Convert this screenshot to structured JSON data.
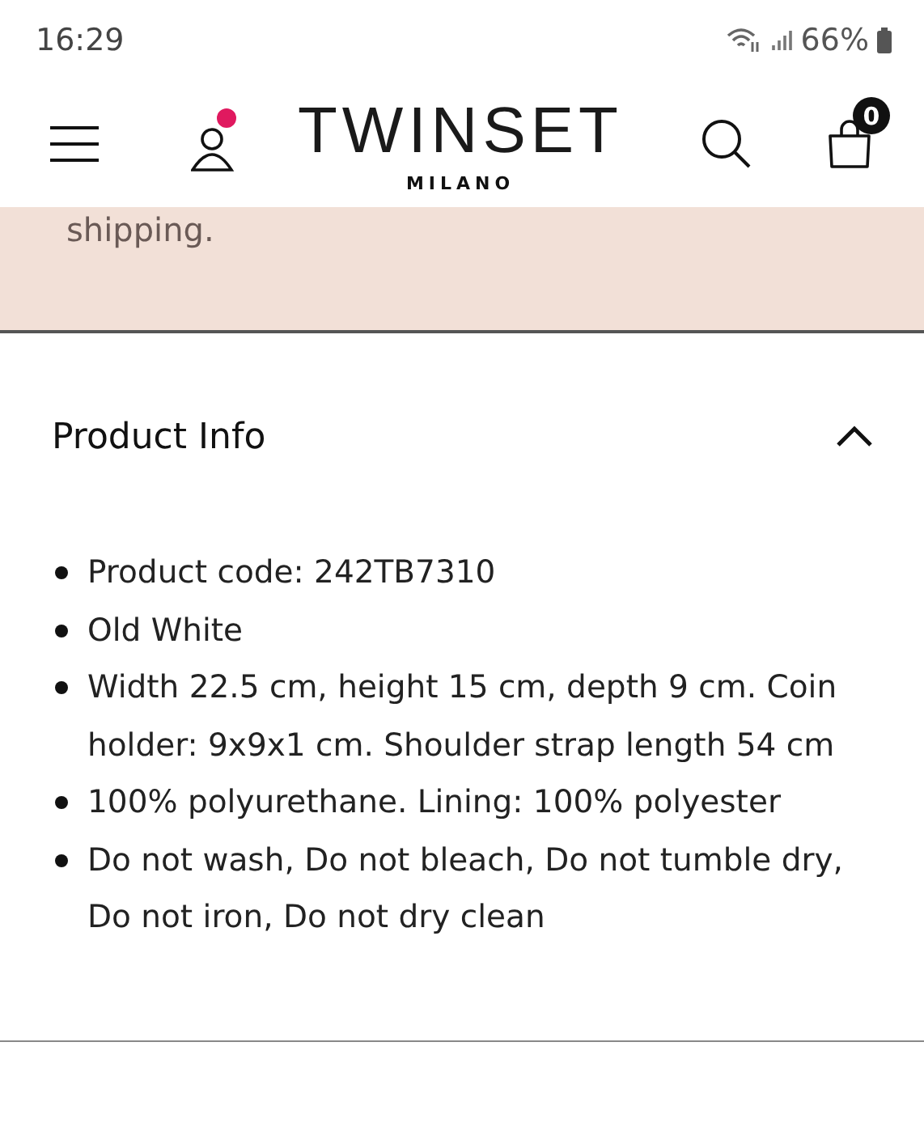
{
  "status_bar": {
    "time": "16:29",
    "battery": "66%"
  },
  "header": {
    "logo": "TWINSET",
    "sublogo": "MILANO",
    "account_notification": true,
    "cart_count": "0"
  },
  "banner": {
    "text": "shipping."
  },
  "section": {
    "title": "Product Info",
    "expanded": true,
    "items": [
      "Product code: 242TB7310",
      "Old White",
      "Width 22.5 cm, height 15 cm, depth 9 cm. Coin holder: 9x9x1 cm. Shoulder strap length 54 cm",
      "100% polyurethane. Lining: 100% polyester",
      "Do not wash, Do not bleach, Do not tumble dry, Do not iron, Do not dry clean"
    ]
  }
}
